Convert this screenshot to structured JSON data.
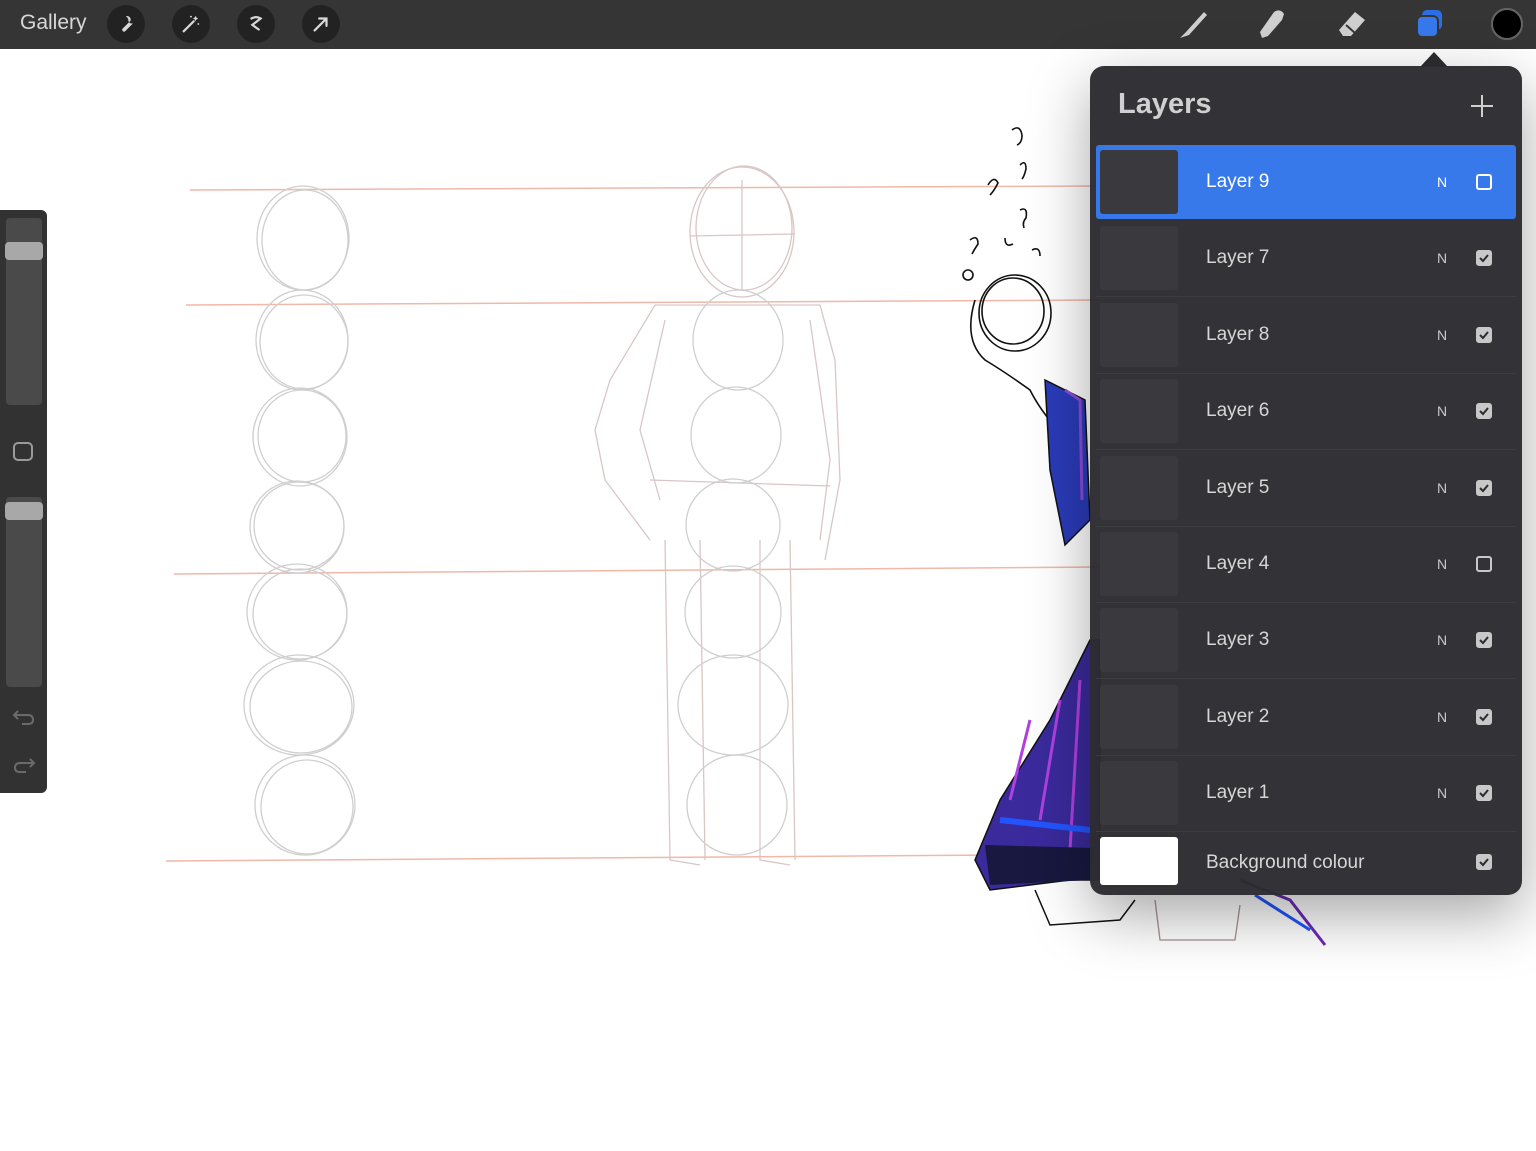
{
  "topbar": {
    "gallery_label": "Gallery",
    "left_tools": [
      "wrench-icon",
      "magic-wand-icon",
      "selection-icon",
      "transform-arrow-icon"
    ],
    "right_tools": [
      "brush-icon",
      "smudge-icon",
      "eraser-icon",
      "layers-icon"
    ],
    "accent": "#3779eb",
    "current_color": "#000000"
  },
  "sidebar": {
    "brush_size_level": 0.86,
    "opacity_level": 0.97,
    "icons": [
      "modify-square-icon",
      "undo-icon",
      "redo-icon"
    ]
  },
  "layers_panel": {
    "title": "Layers",
    "add_icon": "plus-icon",
    "layers": [
      {
        "name": "Layer 9",
        "blend": "N",
        "visible": false,
        "active": true
      },
      {
        "name": "Layer 7",
        "blend": "N",
        "visible": true,
        "active": false
      },
      {
        "name": "Layer 8",
        "blend": "N",
        "visible": true,
        "active": false
      },
      {
        "name": "Layer 6",
        "blend": "N",
        "visible": true,
        "active": false
      },
      {
        "name": "Layer 5",
        "blend": "N",
        "visible": true,
        "active": false
      },
      {
        "name": "Layer 4",
        "blend": "N",
        "visible": false,
        "active": false
      },
      {
        "name": "Layer 3",
        "blend": "N",
        "visible": true,
        "active": false
      },
      {
        "name": "Layer 2",
        "blend": "N",
        "visible": true,
        "active": false
      },
      {
        "name": "Layer 1",
        "blend": "N",
        "visible": true,
        "active": false
      }
    ],
    "background": {
      "name": "Background colour",
      "visible": true,
      "color": "#ffffff"
    }
  }
}
